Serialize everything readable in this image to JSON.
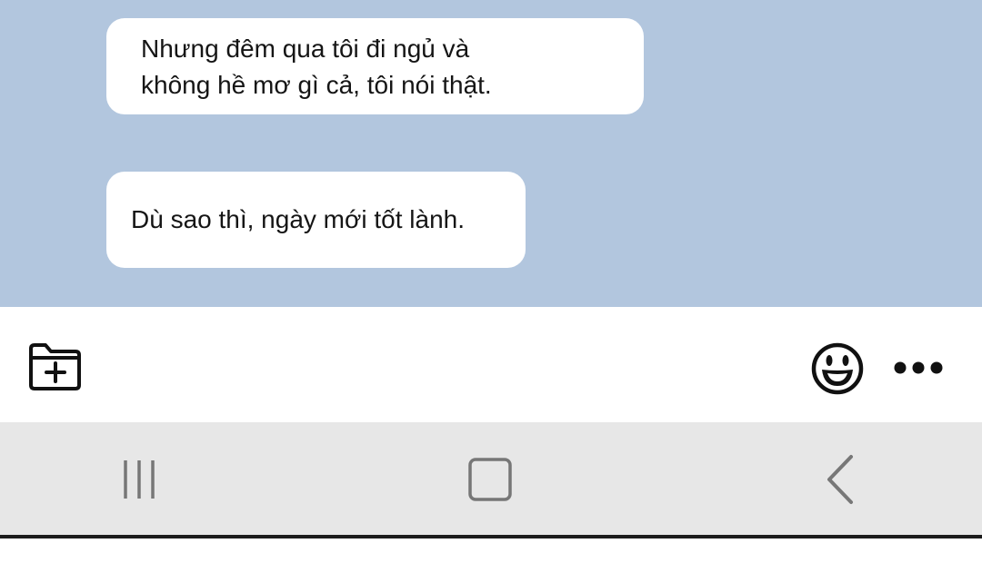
{
  "chat": {
    "background_color": "#b2c6de",
    "messages": [
      {
        "lines": [
          "Nhưng đêm qua tôi đi ngủ và",
          "không hề mơ gì cả, tôi nói thật."
        ]
      },
      {
        "lines": [
          "Dù sao thì, ngày mới tốt lành."
        ]
      }
    ]
  },
  "input_bar": {
    "attach_icon": "folder-plus-icon",
    "emoji_icon": "smiley-face-icon",
    "more_icon": "more-dots-icon"
  },
  "nav_bar": {
    "background_color": "#e7e7e7",
    "recents_icon": "recent-apps-icon",
    "home_icon": "home-square-icon",
    "back_icon": "back-chevron-icon"
  }
}
